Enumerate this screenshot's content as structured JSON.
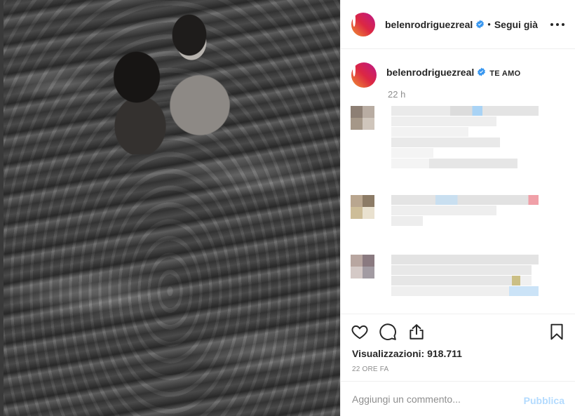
{
  "post": {
    "username": "belenrodriguezreal",
    "follow_separator": "•",
    "follow_label": "Segui già",
    "more_icon": "more-options-icon",
    "verified_color": "#3897f0"
  },
  "caption": {
    "username": "belenrodriguezreal",
    "text": "TE AMO",
    "time": "22 h"
  },
  "actions": {
    "like_icon": "heart-icon",
    "comment_icon": "comment-icon",
    "share_icon": "share-icon",
    "save_icon": "bookmark-icon",
    "views": "Visualizzazioni: 918.711",
    "ago": "22 ORE FA"
  },
  "add_comment": {
    "placeholder": "Aggiungi un commento...",
    "publish_label": "Pubblica",
    "publish_color": "#b3dbff"
  }
}
